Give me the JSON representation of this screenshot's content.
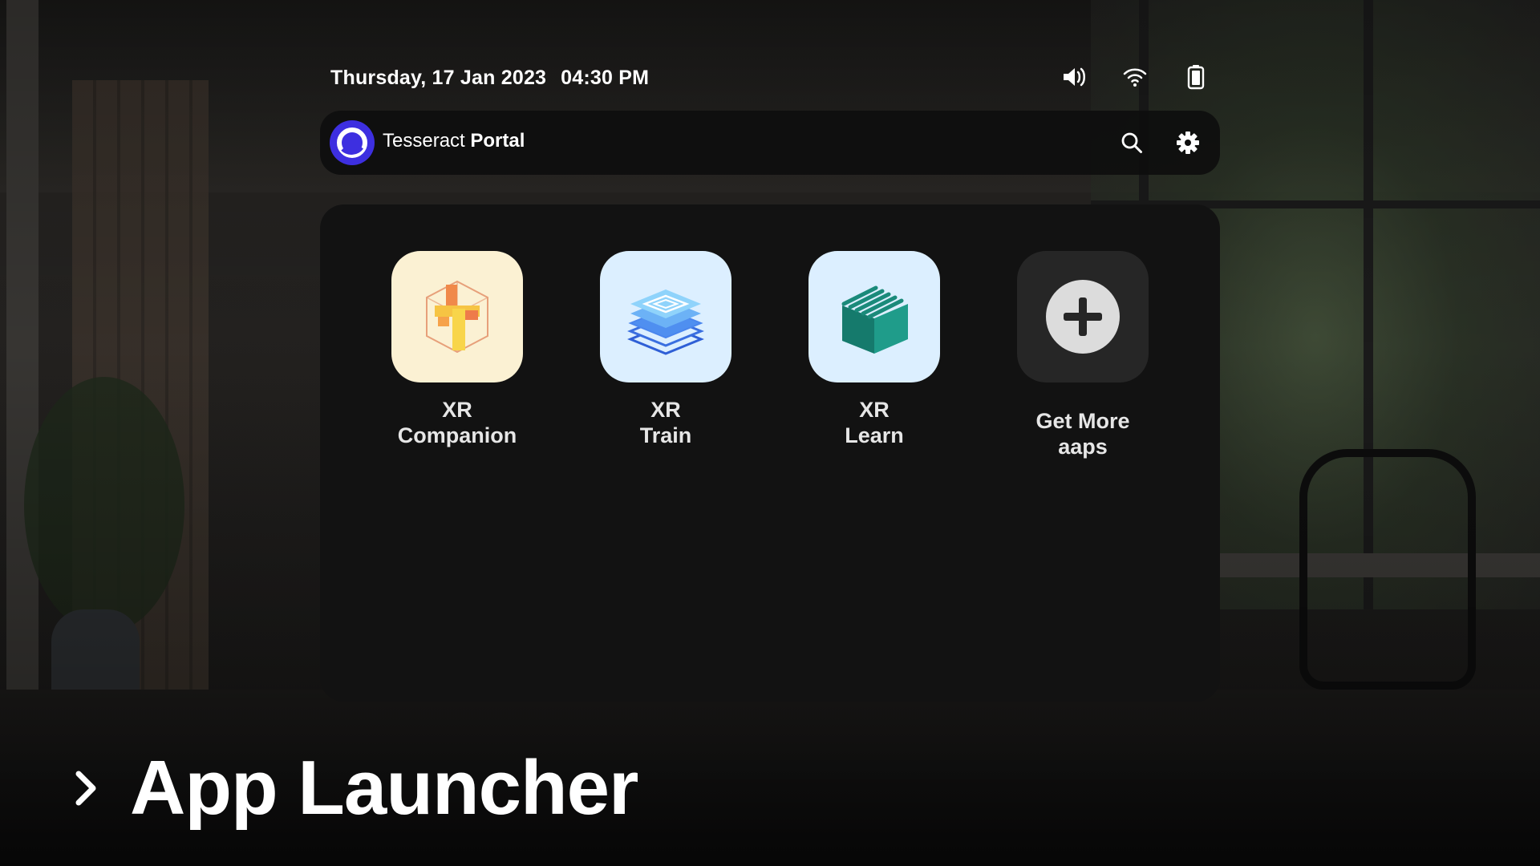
{
  "status_bar": {
    "date": "Thursday, 17 Jan 2023",
    "time": "04:30 PM",
    "icons": [
      "speaker-icon",
      "wifi-icon",
      "battery-icon"
    ]
  },
  "header": {
    "brand_regular": "Tesseract",
    "brand_bold": "Portal",
    "logo_icon": "tesseract-logo-icon",
    "actions": [
      "search-icon",
      "gear-icon"
    ],
    "logo_color": "#3d2fe0"
  },
  "apps": [
    {
      "line1": "XR",
      "line2": "Companion",
      "icon": "xr-companion-icon",
      "tile_color": "#fbf1d3"
    },
    {
      "line1": "XR",
      "line2": "Train",
      "icon": "xr-train-icon",
      "tile_color": "#dcefff"
    },
    {
      "line1": "XR",
      "line2": "Learn",
      "icon": "xr-learn-icon",
      "tile_color": "#dcefff"
    },
    {
      "line1": "Get More",
      "line2": "aaps",
      "icon": "plus-icon",
      "tile_color": "#262626"
    }
  ],
  "caption": {
    "label": "App Launcher",
    "icon": "chevron-right-icon"
  },
  "colors": {
    "panel": "#121212",
    "header": "#0e0e0e",
    "text": "#ffffff"
  }
}
